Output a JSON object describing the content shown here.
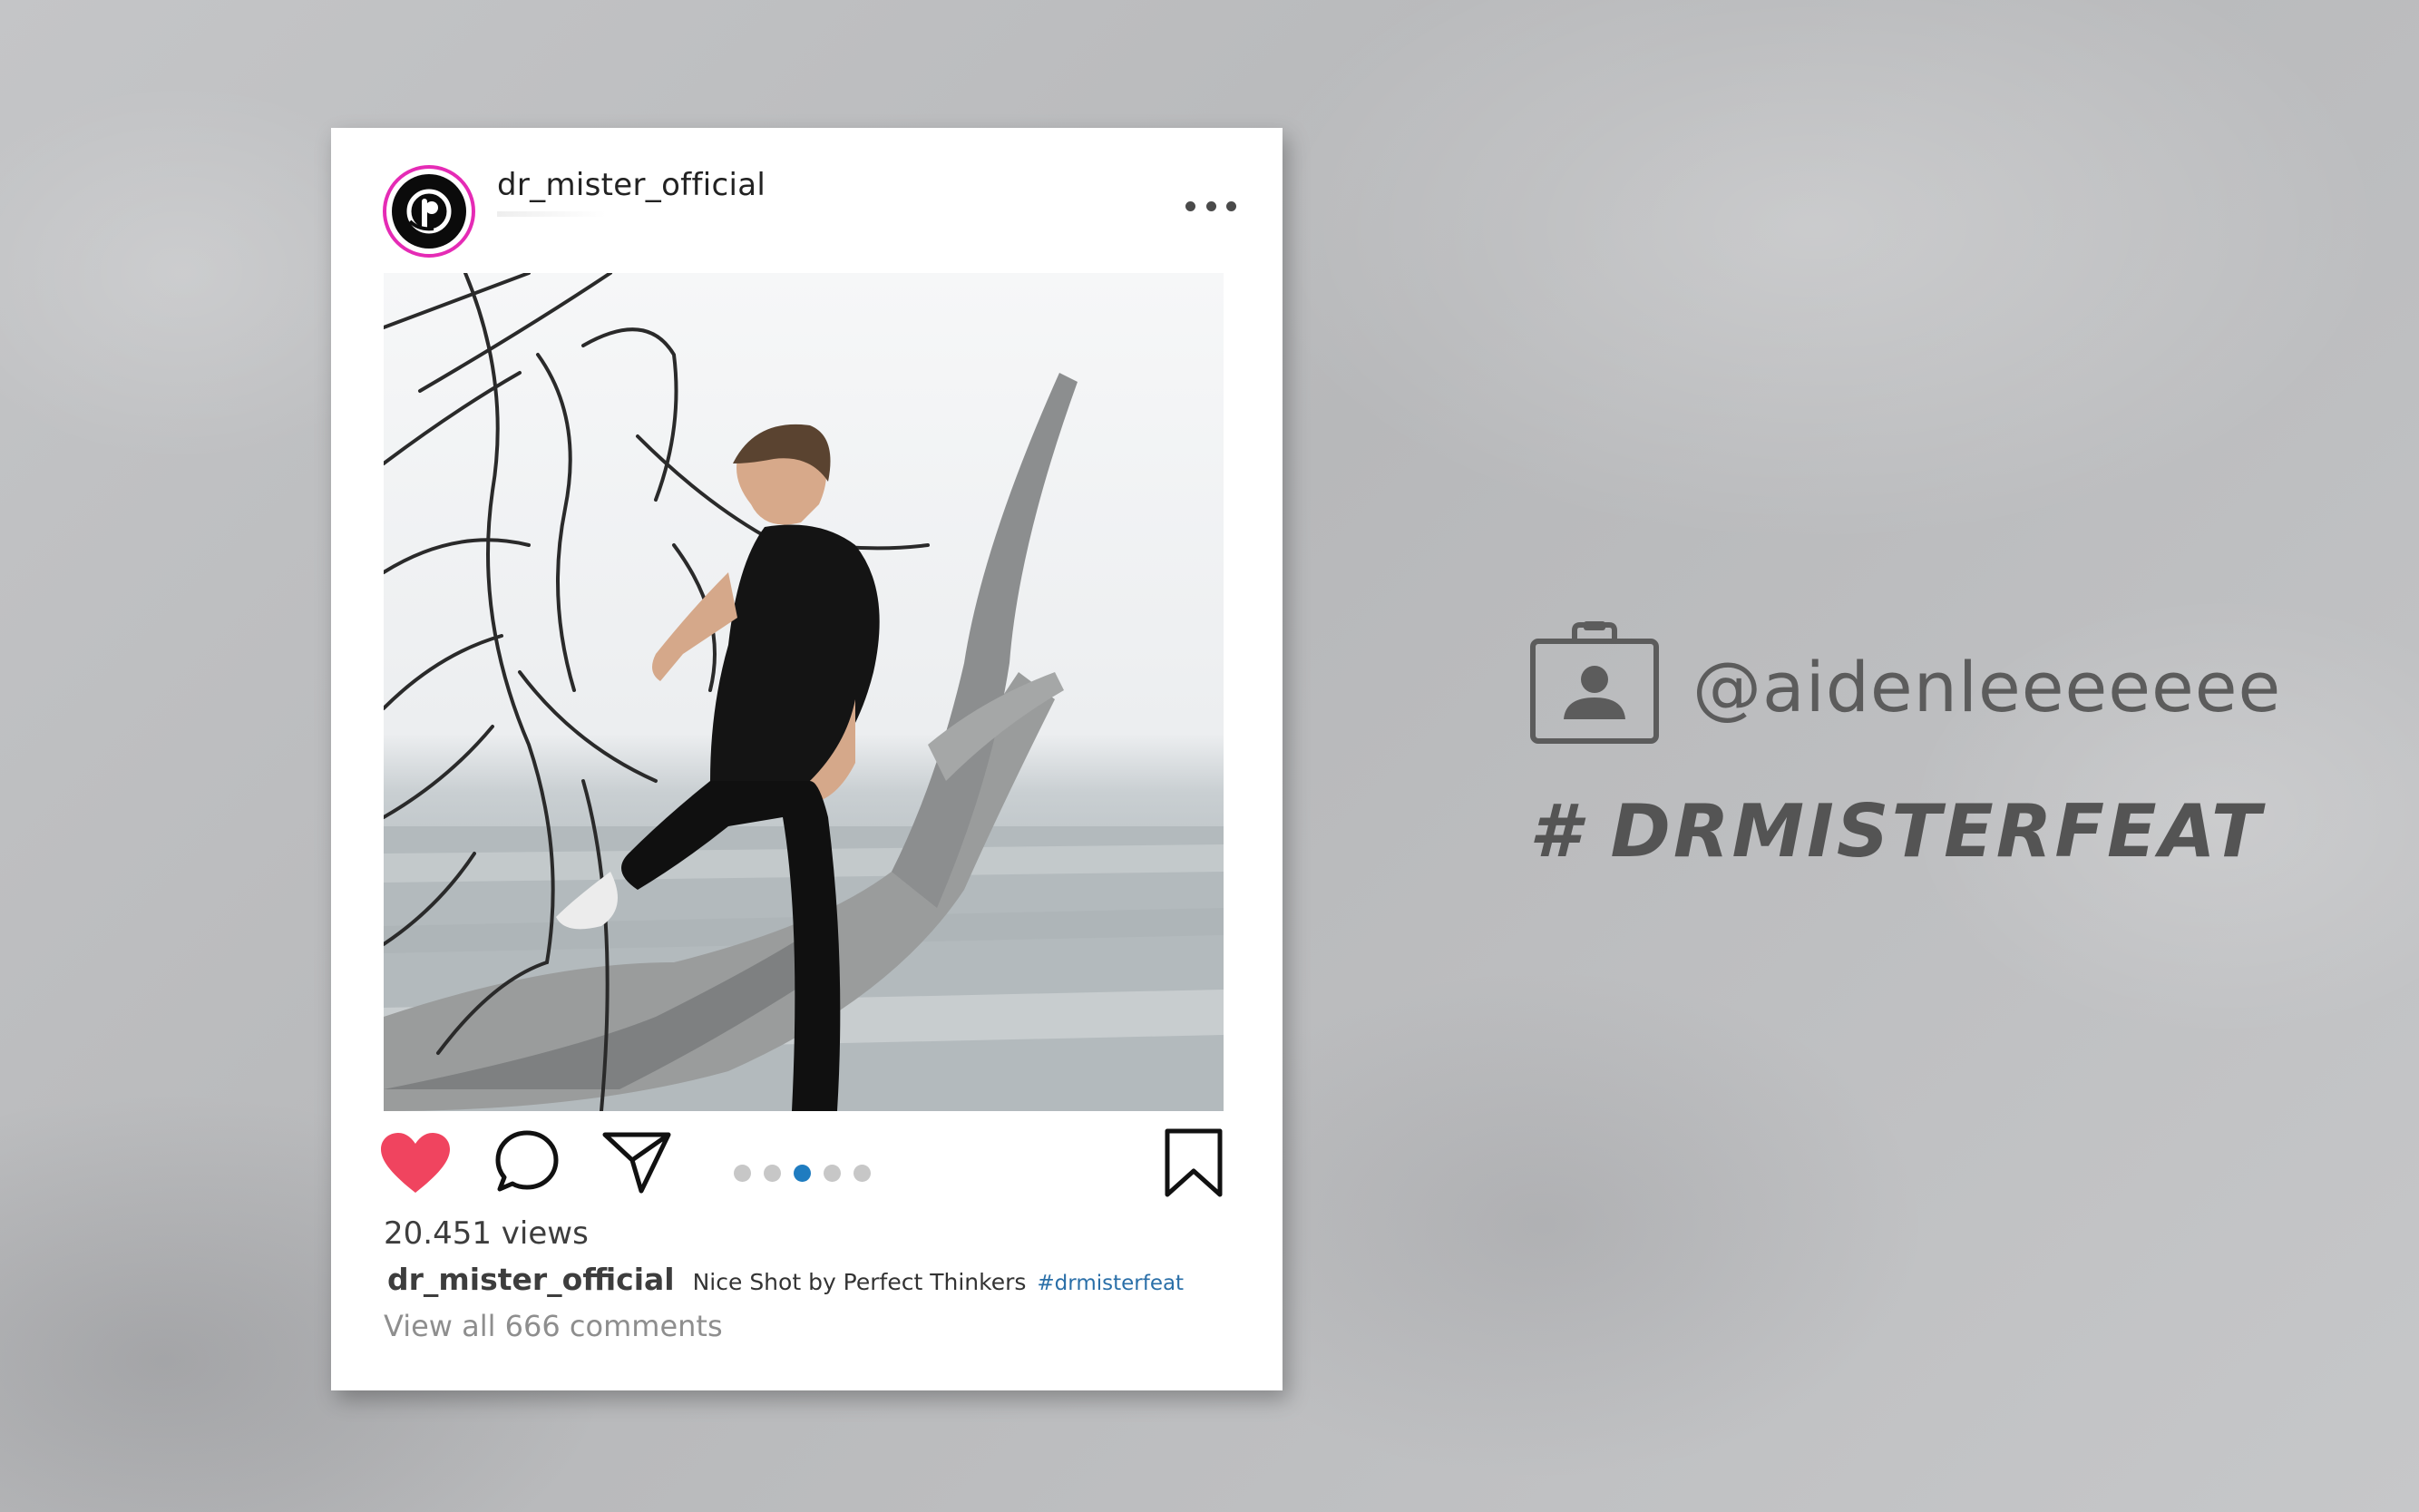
{
  "post": {
    "username": "dr_mister_official",
    "views": "20.451 views",
    "caption_user": "dr_mister_official",
    "caption_text": "Nice Shot by Perfect Thinkers",
    "caption_hashtag": "#drmisterfeat",
    "comments_link": "View all 666 comments",
    "carousel": {
      "total": 5,
      "active_index": 3
    },
    "liked": true,
    "colors": {
      "heart": "#f0445f",
      "ring": "#e52bb5",
      "active_dot": "#1f7cc0",
      "hashtag": "#2a6fa8"
    }
  },
  "promo": {
    "handle": "@aidenleeeeeee",
    "hashtag": "# DRMISTERFEAT"
  },
  "icons": [
    "avatar-logo",
    "more-options-icon",
    "heart-icon",
    "comment-icon",
    "share-icon",
    "bookmark-icon",
    "contact-card-icon"
  ]
}
